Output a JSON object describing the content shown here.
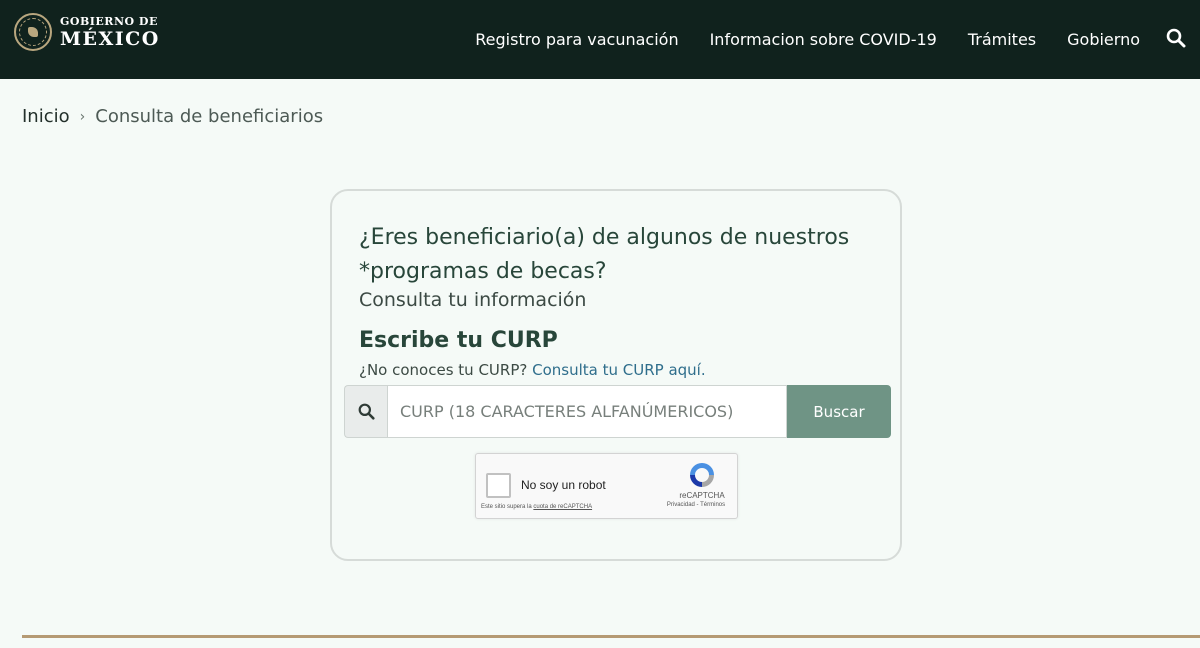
{
  "header": {
    "logo_small": "GOBIERNO DE",
    "logo_big": "MÉXICO",
    "nav": [
      "Registro para vacunación",
      "Informacion sobre COVID-19",
      "Trámites",
      "Gobierno"
    ],
    "search_icon": "search-icon"
  },
  "breadcrumb": {
    "home": "Inicio",
    "separator": "›",
    "current": "Consulta de beneficiarios"
  },
  "card": {
    "title": "¿Eres beneficiario(a) de algunos de nuestros *programas de becas?",
    "subtitle": "Consulta tu información",
    "curp_heading": "Escribe tu CURP",
    "hint_text": "¿No conoces tu CURP?",
    "hint_link": "Consulta tu CURP aquí.",
    "search_placeholder": "CURP (18 CARACTERES ALFANÚMERICOS)",
    "search_value": "",
    "button_label": "Buscar"
  },
  "recaptcha": {
    "label": "No soy un robot",
    "brand": "reCAPTCHA",
    "links": "Privacidad - Términos",
    "note_prefix": "Este sitio supera la",
    "note_link": "cuota de reCAPTCHA"
  },
  "colors": {
    "header_bg": "#10221d",
    "page_bg": "#f5faf7",
    "accent_green": "#6f9485",
    "title_green": "#28463a",
    "link_blue": "#2f6e8c",
    "rule_gold": "#b59a74"
  }
}
